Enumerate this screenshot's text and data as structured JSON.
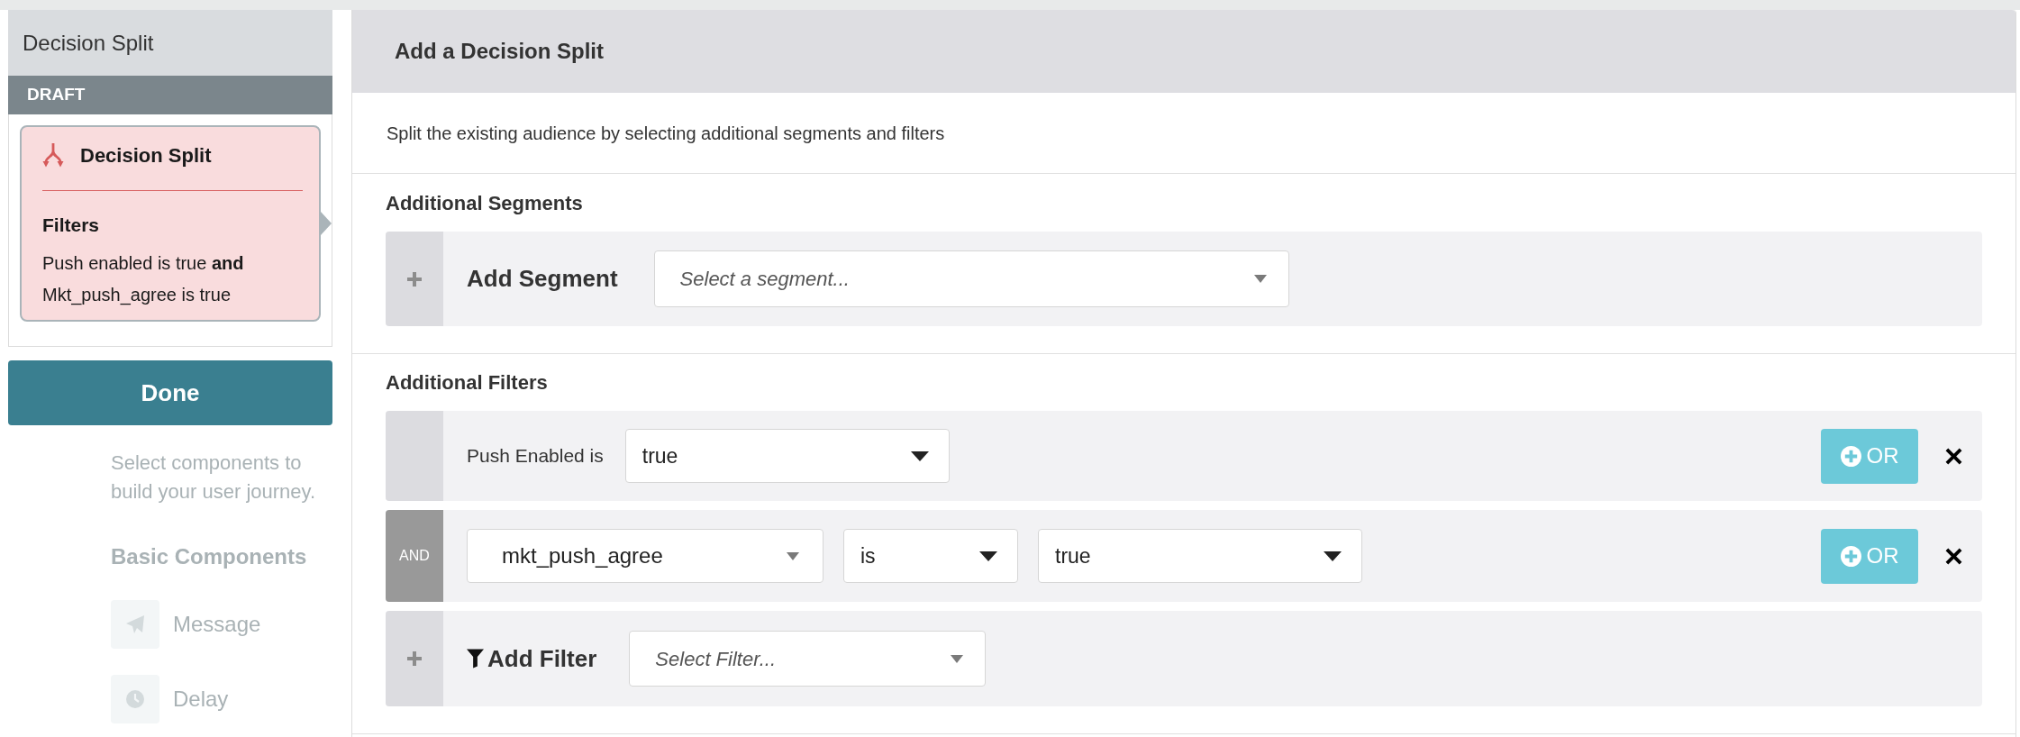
{
  "background": {
    "intro": "Select components to build your user journey.",
    "section_title": "Basic Components",
    "components": [
      {
        "label": "Message"
      },
      {
        "label": "Delay"
      }
    ]
  },
  "node_panel": {
    "title": "Decision Split",
    "status": "DRAFT",
    "card": {
      "title": "Decision Split",
      "section_title": "Filters",
      "summary": "Push enabled is true **and** Mkt_push_agree is true"
    },
    "done_button": "Done"
  },
  "dialog": {
    "title": "Add a Decision Split",
    "description": "Split the existing audience by selecting additional segments and filters",
    "segments": {
      "heading": "Additional Segments",
      "add_label": "Add Segment",
      "select": {
        "kind": "combobox",
        "placeholder": "Select a segment..."
      }
    },
    "filters": {
      "heading": "Additional Filters",
      "rows": [
        {
          "label": "Push Enabled is",
          "selects": [
            {
              "kind": "dropdown",
              "value": "true"
            }
          ],
          "or_button": "OR"
        },
        {
          "connector": "AND",
          "selects": [
            {
              "kind": "combobox",
              "value": "mkt_push_agree"
            },
            {
              "kind": "dropdown",
              "value": "is"
            },
            {
              "kind": "dropdown",
              "value": "true"
            }
          ],
          "or_button": "OR"
        }
      ],
      "add_label": "Add Filter",
      "add_select": {
        "kind": "combobox",
        "placeholder": "Select Filter..."
      }
    }
  }
}
